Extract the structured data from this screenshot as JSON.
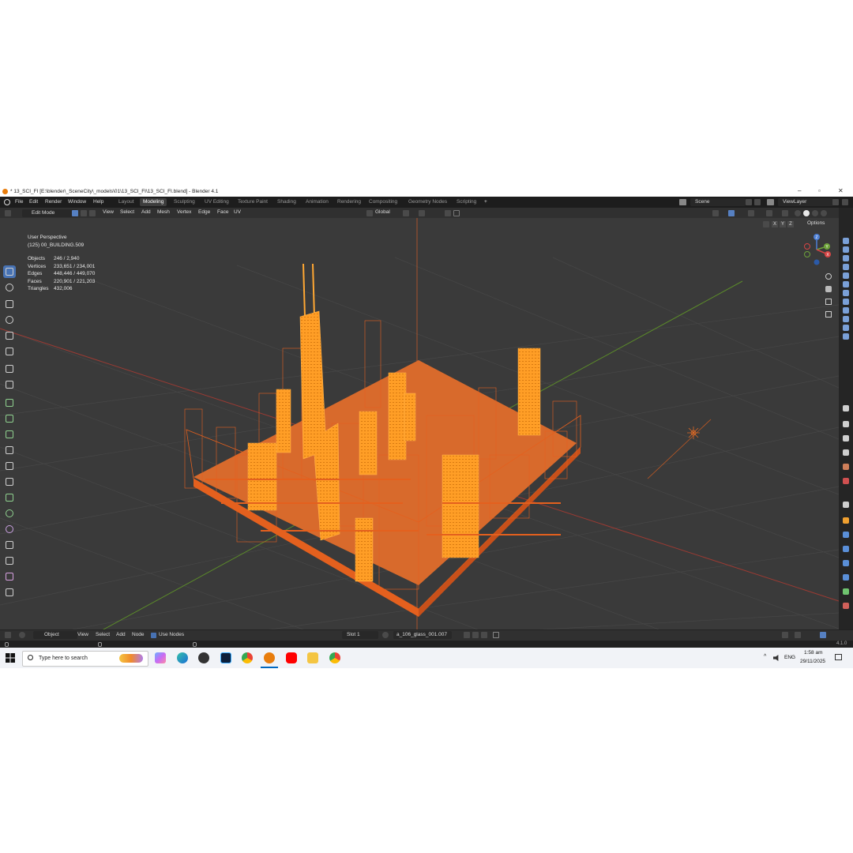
{
  "window": {
    "title": "* 13_SCI_FI [E:\\blender\\_SceneCity\\_models\\01\\13_SCI_FI\\13_SCI_FI.blend] - Blender 4.1",
    "controls": [
      "–",
      "▫",
      "✕"
    ]
  },
  "menu": [
    "File",
    "Edit",
    "Render",
    "Window",
    "Help"
  ],
  "workspaces": [
    "Layout",
    "Modeling",
    "Sculpting",
    "UV Editing",
    "Texture Paint",
    "Shading",
    "Animation",
    "Rendering",
    "Compositing",
    "Geometry Nodes",
    "Scripting"
  ],
  "active_workspace": "Modeling",
  "add_workspace": "+",
  "scene": "Scene",
  "view_layer": "ViewLayer",
  "header": {
    "mode": "Edit Mode",
    "menus": [
      "View",
      "Select",
      "Add",
      "Mesh",
      "Vertex",
      "Edge",
      "Face",
      "UV"
    ],
    "orientation": "Global",
    "options": "Options",
    "axes": [
      "X",
      "Y",
      "Z"
    ]
  },
  "viewport": {
    "view_name": "User Perspective",
    "object_name": "(125) 00_BUILDING.509",
    "stats": [
      {
        "label": "Objects",
        "value": "246 / 2,940"
      },
      {
        "label": "Vertices",
        "value": "233,651 / 234,001"
      },
      {
        "label": "Edges",
        "value": "448,446 / 449,070"
      },
      {
        "label": "Faces",
        "value": "220,901 / 221,203"
      },
      {
        "label": "Triangles",
        "value": "432,006"
      }
    ],
    "gizmo": {
      "x": "X",
      "y": "Y",
      "z": "Z"
    }
  },
  "node_header": {
    "mode": "Object",
    "menus": [
      "View",
      "Select",
      "Add",
      "Node"
    ],
    "use_nodes": "Use Nodes",
    "slot": "Slot 1",
    "material": "a_106_glass_001.007"
  },
  "status_bar": {
    "version": "4.1.0"
  },
  "taskbar": {
    "search_placeholder": "Type here to search",
    "language": "ENG",
    "time": "1:58 am",
    "date": "29/11/2025"
  },
  "colors": {
    "selection": "#ff9a1f",
    "edge": "#e8611a",
    "mesh": "#8c8c8c",
    "active_tab": "#4772b3"
  }
}
